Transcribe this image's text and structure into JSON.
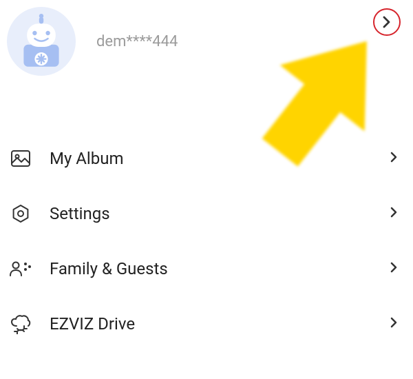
{
  "profile": {
    "username": "dem****444"
  },
  "menu": {
    "items": [
      {
        "label": "My Album"
      },
      {
        "label": "Settings"
      },
      {
        "label": "Family & Guests"
      },
      {
        "label": "EZVIZ Drive"
      }
    ]
  },
  "colors": {
    "highlight_ring": "#d6242c",
    "pointer_arrow": "#ffd400"
  }
}
